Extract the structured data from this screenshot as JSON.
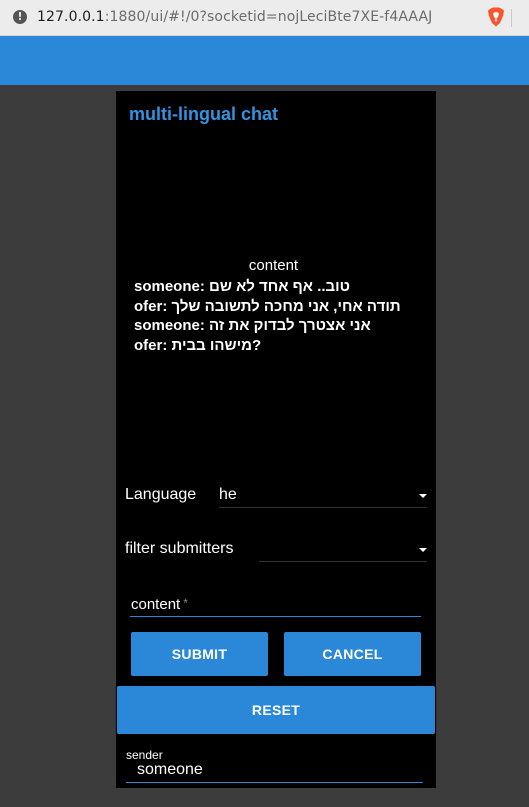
{
  "browser": {
    "url_host": "127.0.0.1",
    "url_rest": ":1880/ui/#!/0?socketid=nojLeciBte7XE-f4AAAJ",
    "info_icon": "info-icon",
    "extension_icon": "brave-lion-icon"
  },
  "card": {
    "title": "multi-lingual chat",
    "content_label": "content",
    "messages": [
      "someone: טוב.. אף אחד לא שם",
      "ofer: תודה אחי, אני מחכה לתשובה שלך",
      "someone: אני אצטרך לבדוק את זה",
      "ofer: מישהו בבית?"
    ],
    "language": {
      "label": "Language",
      "value": "he"
    },
    "filter": {
      "label": "filter submitters",
      "value": ""
    },
    "content_input": {
      "placeholder": "content",
      "required_mark": "*"
    },
    "buttons": {
      "submit": "SUBMIT",
      "cancel": "CANCEL",
      "reset": "RESET"
    },
    "sender": {
      "label": "sender",
      "value": "someone"
    }
  },
  "colors": {
    "accent": "#2b88d8",
    "title": "#3293e0",
    "background": "#3c3c3c",
    "card": "#000000"
  }
}
